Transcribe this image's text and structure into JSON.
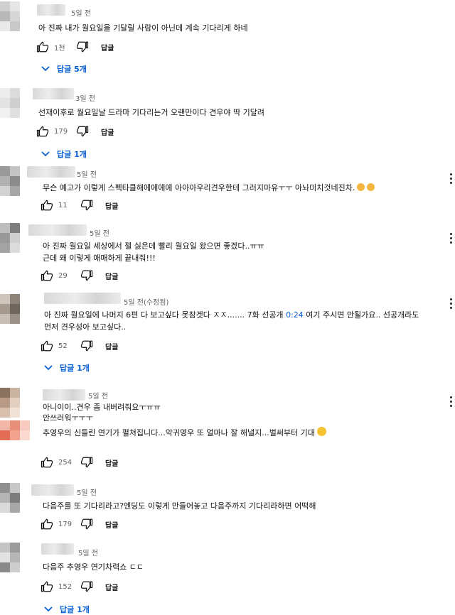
{
  "labels": {
    "reply": "답글"
  },
  "comments": [
    {
      "time": "5일 전",
      "text": "아 진짜 내가 월요일을 기달릴 사람이 아닌데 계속 기다리게 하네",
      "likes": "1천",
      "replies": "답글 5개"
    },
    {
      "time": "3일 전",
      "text": "선재이후로 월요일날 드라마 기다리는거 오랜만이다 견우야 딱 기달려",
      "likes": "179",
      "replies": "답글 1개"
    },
    {
      "time": "5일 전",
      "text": "무슨 예고가 이렇게 스펙타클해에에에에 아아아우리견우한테 그러지마유ㅜㅜ 아놔미치것네진차.",
      "likes": "11"
    },
    {
      "time": "5일 전",
      "text1": "아 진짜 월요일 세상에서 젤 싫은데 빨리 월요일 왔으면 좋겠다..ㅠㅠ",
      "text2": "근데 왜 이렇게 애매하게 끝내줘!!!",
      "likes": "29"
    },
    {
      "time": "5일 전(수정됨)",
      "text1_pre": "아 진짜 월요일에 나머지 6편 다 보고싶다 못참겟다 ㅈㅈ....... 7화 선공개 ",
      "timestamp": "0:24",
      "text1_post": " 여기 주시면 안될가요.. 선공개라도",
      "text2": "먼저 견우성아 보고싶다..",
      "likes": "52",
      "replies": "답글 1개"
    },
    {
      "time": "5일 전",
      "text1": "아니이이..견우 좀 내버려줘요ㅜㅠㅠ",
      "text2": "안쓰러워ㅜㅜㅜ",
      "text3": "추영우의 신들린 연기가 펼쳐집니다...악귀영우 또 얼마나 잘 해낼지...벌써부터 기대",
      "likes": "254"
    },
    {
      "time": "5일 전",
      "text": "다음주를 또 기다리라고?엔딩도 이렇게 만들어놓고 다음주까지 기다리라하면 어떡해",
      "likes": "179"
    },
    {
      "time": "5일 전",
      "text": "다음주 추영우 연기차력쇼 ㄷㄷ",
      "likes": "152",
      "replies": "답글 1개"
    }
  ]
}
